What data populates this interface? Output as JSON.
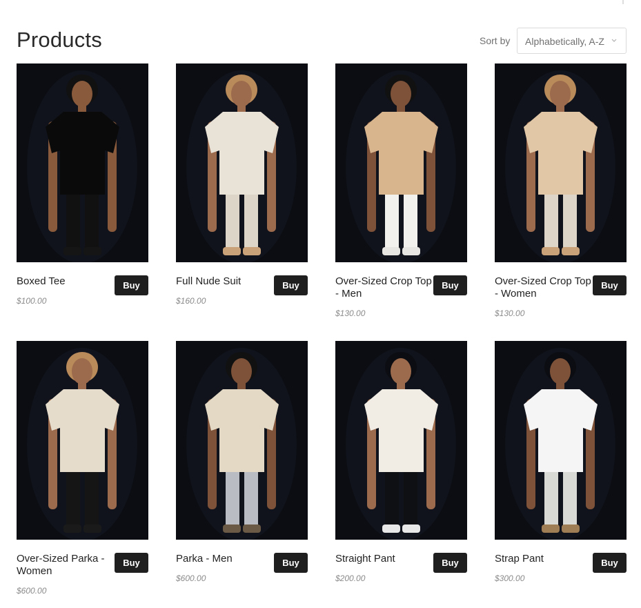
{
  "page": {
    "title": "Products"
  },
  "sort": {
    "label": "Sort by",
    "value": "Alphabetically, A-Z"
  },
  "products": [
    {
      "name": "Boxed Tee",
      "price": "$100.00",
      "buy_label": "Buy",
      "photo": {
        "skin": "#8a5a3c",
        "hair": "#111111",
        "top": "#0a0a0a",
        "bottom": "#111111",
        "shoes": "#151515",
        "under": "#0a0a0a"
      }
    },
    {
      "name": "Full Nude Suit",
      "price": "$160.00",
      "buy_label": "Buy",
      "photo": {
        "skin": "#9c6a4c",
        "hair": "#b98a5a",
        "top": "#e9e2d6",
        "bottom": "#ddd5c8",
        "shoes": "#c9a27a",
        "under": "#e9e2d6"
      }
    },
    {
      "name": "Over-Sized Crop Top - Men",
      "price": "$130.00",
      "buy_label": "Buy",
      "photo": {
        "skin": "#7e5238",
        "hair": "#111111",
        "top": "#d9b58e",
        "bottom": "#f3f1ee",
        "shoes": "#e8e6e2",
        "under": "#ffffff"
      }
    },
    {
      "name": "Over-Sized Crop Top - Women",
      "price": "$130.00",
      "buy_label": "Buy",
      "photo": {
        "skin": "#9c6a4c",
        "hair": "#b98a5a",
        "top": "#e2c7a6",
        "bottom": "#ddd5c8",
        "shoes": "#c9a27a",
        "under": "#f1ece4"
      }
    },
    {
      "name": "Over-Sized Parka - Women",
      "price": "$600.00",
      "buy_label": "Buy",
      "photo": {
        "skin": "#9c6a4c",
        "hair": "#b98a5a",
        "top": "#e6dccb",
        "bottom": "#151515",
        "shoes": "#1a1a1a",
        "under": "#e9dcd0"
      }
    },
    {
      "name": "Parka - Men",
      "price": "$600.00",
      "buy_label": "Buy",
      "photo": {
        "skin": "#7e5238",
        "hair": "#111111",
        "top": "#e3d9c5",
        "bottom": "#b9bcc2",
        "shoes": "#6b5a45",
        "under": "#f5f5f5"
      }
    },
    {
      "name": "Straight Pant",
      "price": "$200.00",
      "buy_label": "Buy",
      "photo": {
        "skin": "#9c6a4c",
        "hair": "#0b0d12",
        "top": "#f1ece4",
        "bottom": "#0f1014",
        "shoes": "#e8e8e8",
        "under": "#f1ece4"
      }
    },
    {
      "name": "Strap Pant",
      "price": "$300.00",
      "buy_label": "Buy",
      "photo": {
        "skin": "#7e5238",
        "hair": "#0b0d12",
        "top": "#f5f5f5",
        "bottom": "#d9d9d6",
        "shoes": "#a07e55",
        "under": "#f5f5f5"
      }
    }
  ]
}
